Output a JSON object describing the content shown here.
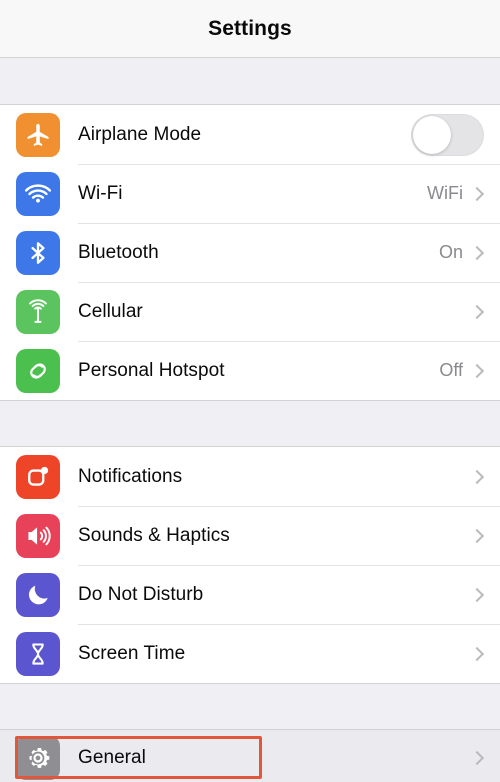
{
  "header": {
    "title": "Settings"
  },
  "colors": {
    "airplane": "#F09030",
    "wifi": "#3E78E8",
    "bluetooth": "#3E78E8",
    "cellular": "#5CC45E",
    "hotspot": "#4CC04F",
    "notifications": "#EE4427",
    "sounds": "#E8415A",
    "dnd": "#5B55D0",
    "screentime": "#5B55D0",
    "general": "#8E8E93",
    "highlight": "#E2573A",
    "chevron": "#B9B9BE",
    "value_text": "#8A8A8E",
    "background": "#EFEFF4"
  },
  "sections": [
    {
      "name": "connectivity",
      "rows": [
        {
          "label": "Airplane Mode",
          "value": "",
          "icon": "airplane-icon",
          "control": "toggle",
          "toggle_on": false,
          "chevron": false
        },
        {
          "label": "Wi-Fi",
          "value": "WiFi",
          "icon": "wifi-icon",
          "control": "chevron",
          "chevron": true
        },
        {
          "label": "Bluetooth",
          "value": "On",
          "icon": "bluetooth-icon",
          "control": "chevron",
          "chevron": true
        },
        {
          "label": "Cellular",
          "value": "",
          "icon": "cellular-antenna-icon",
          "control": "chevron",
          "chevron": true
        },
        {
          "label": "Personal Hotspot",
          "value": "Off",
          "icon": "personal-hotspot-icon",
          "control": "chevron",
          "chevron": true
        }
      ]
    },
    {
      "name": "alerts",
      "rows": [
        {
          "label": "Notifications",
          "value": "",
          "icon": "notifications-icon",
          "control": "chevron",
          "chevron": true
        },
        {
          "label": "Sounds & Haptics",
          "value": "",
          "icon": "speaker-icon",
          "control": "chevron",
          "chevron": true
        },
        {
          "label": "Do Not Disturb",
          "value": "",
          "icon": "moon-icon",
          "control": "chevron",
          "chevron": true
        },
        {
          "label": "Screen Time",
          "value": "",
          "icon": "hourglass-icon",
          "control": "chevron",
          "chevron": true
        }
      ]
    },
    {
      "name": "system",
      "rows": [
        {
          "label": "General",
          "value": "",
          "icon": "gear-icon",
          "control": "chevron",
          "chevron": true,
          "highlighted": true
        }
      ]
    }
  ]
}
